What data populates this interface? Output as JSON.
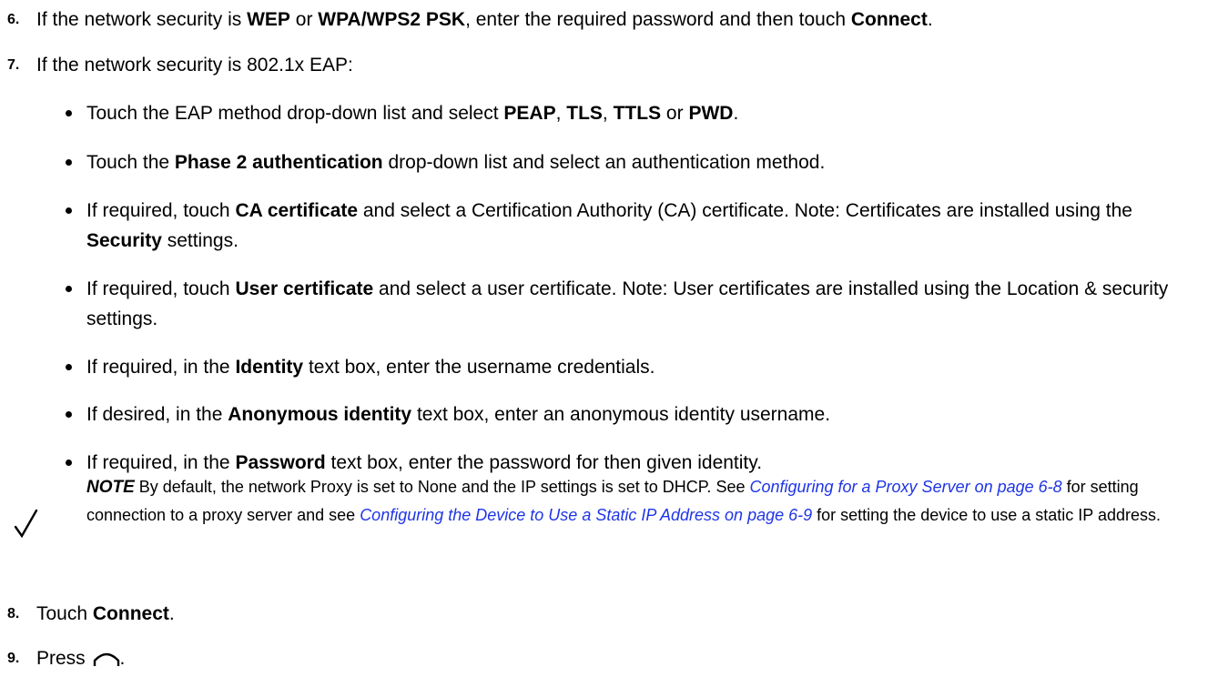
{
  "steps": {
    "s6": {
      "num": "6.",
      "t1": "If the network security is ",
      "b1": "WEP",
      "t2": " or ",
      "b2": "WPA/WPS2 PSK",
      "t3": ", enter the required password and then touch ",
      "b3": "Connect",
      "t4": "."
    },
    "s7": {
      "num": "7.",
      "text": "If the network security is 802.1x EAP:"
    },
    "s8": {
      "num": "8.",
      "t1": "Touch ",
      "b1": "Connect",
      "t2": "."
    },
    "s9": {
      "num": "9.",
      "t1": "Press ",
      "icon": "home-icon",
      "t2": "."
    }
  },
  "bullets": [
    {
      "t1": "Touch the EAP method drop-down list and select ",
      "b1": "PEAP",
      "t2": ", ",
      "b2": "TLS",
      "t3": ", ",
      "b3": "TTLS",
      "t4": " or ",
      "b4": "PWD",
      "t5": "."
    },
    {
      "t1": "Touch the ",
      "b1": "Phase 2 authentication",
      "t2": " drop-down list and select an authentication method."
    },
    {
      "t1": "If required, touch ",
      "b1": "CA certificate",
      "t2": " and select a Certification Authority (CA) certificate. Note: Certificates are installed using the ",
      "b2": "Security",
      "t3": " settings."
    },
    {
      "t1": "If required, touch ",
      "b1": "User certificate",
      "t2": " and select a user certificate. Note: User certificates are installed using the Location & security settings."
    },
    {
      "t1": "If required, in the ",
      "b1": "Identity",
      "t2": " text box, enter the username credentials."
    },
    {
      "t1": "If desired, in the ",
      "b1": "Anonymous identity",
      "t2": " text box, enter an anonymous identity username."
    },
    {
      "t1": "If required, in the ",
      "b1": "Password",
      "t2": " text box, enter the password for then given identity."
    }
  ],
  "note": {
    "label": "NOTE",
    "icon": "checkmark-icon",
    "t1": " By default, the network Proxy is set to None and the IP settings is set to DHCP. See ",
    "link1": "Configuring for a Proxy Server on page 6-8",
    "t2": " for setting connection to a proxy server and see ",
    "link2": "Configuring the Device to Use a Static IP Address on page 6-9",
    "t3": " for setting the device to use a static IP address.",
    "link_color": "#1f35e6"
  }
}
